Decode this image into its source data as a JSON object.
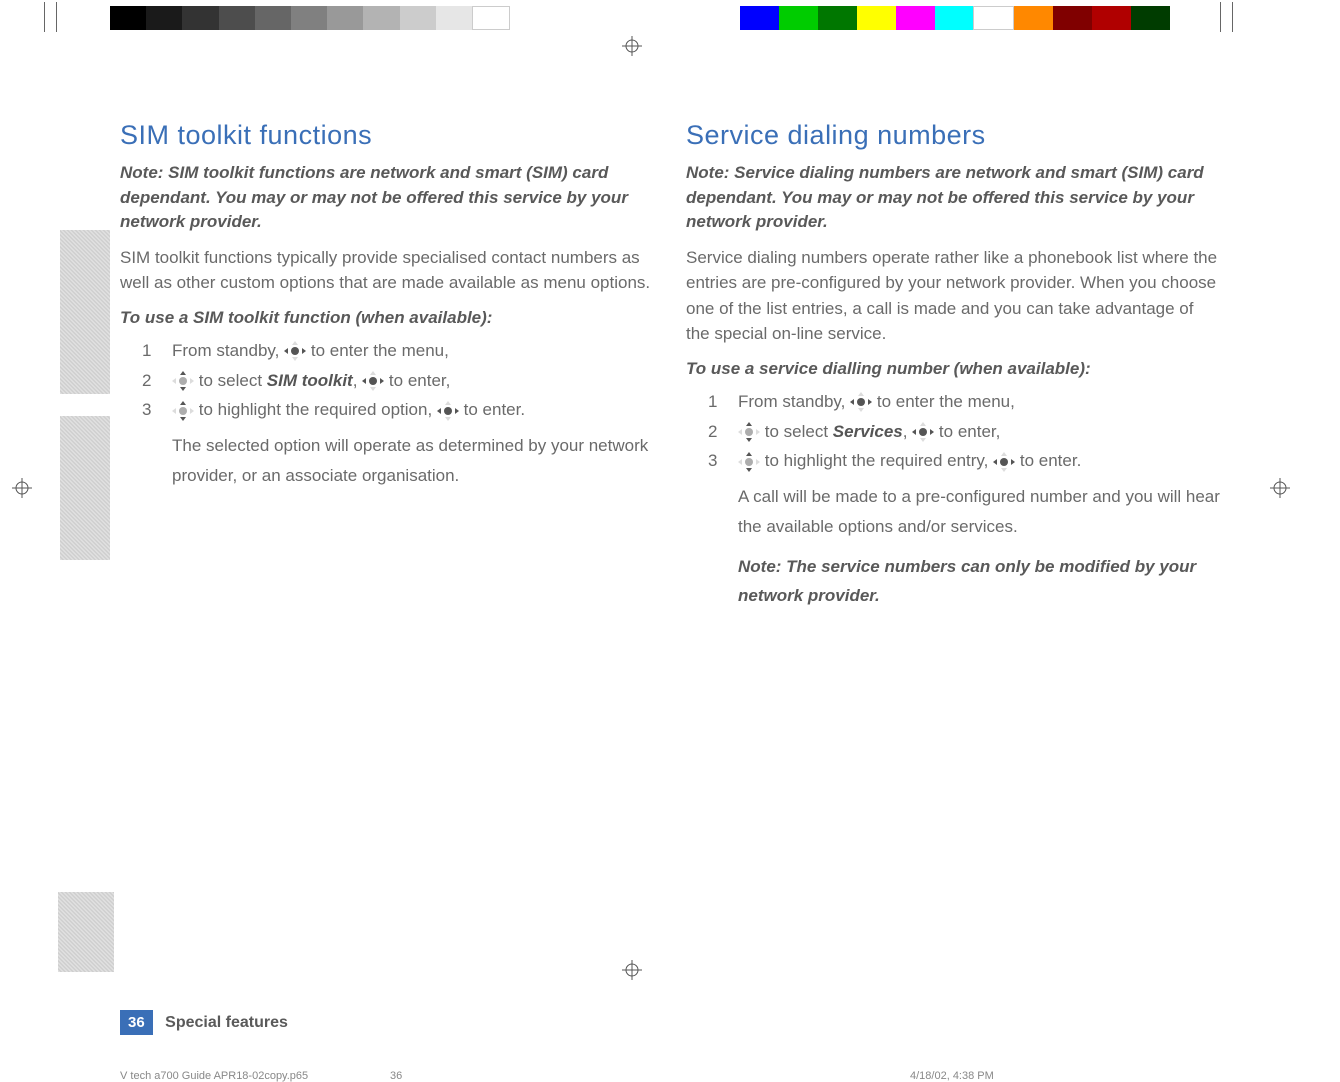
{
  "left": {
    "heading": "SIM toolkit functions",
    "note": "Note: SIM toolkit functions are network and smart (SIM) card dependant. You may or may not be offered this service by your network provider.",
    "body": "SIM toolkit functions typically provide specialised contact numbers as well as other custom options that are made available as menu options.",
    "subhead": "To use a SIM toolkit function (when available):",
    "step1_a": "From standby, ",
    "step1_b": " to enter the menu,",
    "step2_a": " to select ",
    "step2_bold": "SIM toolkit",
    "step2_b": ", ",
    "step2_c": " to enter,",
    "step3_a": " to highlight the required option, ",
    "step3_b": " to enter.",
    "step3_result": "The selected option will operate as determined by your network provider, or an associate organisation."
  },
  "right": {
    "heading": "Service dialing numbers",
    "note": "Note: Service dialing numbers are network and smart (SIM) card dependant. You may or may not be offered this service by your network provider.",
    "body": "Service dialing numbers operate rather like a phonebook list where the entries are pre-configured by your network provider. When you choose one of the list entries, a call is made and you can take advantage of the special on-line service.",
    "subhead": "To use a service dialling number (when available):",
    "step1_a": "From standby, ",
    "step1_b": " to enter the menu,",
    "step2_a": " to select ",
    "step2_bold": "Services",
    "step2_b": ", ",
    "step2_c": " to enter,",
    "step3_a": " to highlight the required entry, ",
    "step3_b": " to enter.",
    "step3_result": "A call will be made to a pre-configured number and you will hear the available options and/or services.",
    "step3_note": "Note: The service numbers can only be modified by your network provider."
  },
  "footer": {
    "pagenum": "36",
    "title": "Special features",
    "file": "V tech a700 Guide APR18-02copy.p65",
    "pg": "36",
    "date": "4/18/02, 4:38 PM"
  },
  "nums": {
    "n1": "1",
    "n2": "2",
    "n3": "3"
  }
}
